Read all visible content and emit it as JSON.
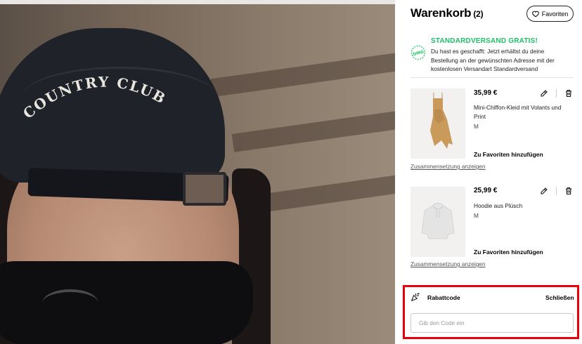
{
  "hero": {
    "cap_text": "COUNTRY CLUB"
  },
  "cart": {
    "title": "Warenkorb",
    "count": "(2)",
    "favorites_button": "Favoriten"
  },
  "shipping": {
    "title": "STANDARDVERSAND GRATIS!",
    "text": "Du hast es geschafft: Jetzt erhältst du deine Bestellung an der gewünschten Adresse mit der kostenlosen Versandart Standardversand",
    "icon": "omg-stamp-icon",
    "color": "#1fbf6a"
  },
  "items": [
    {
      "price": "35,99 €",
      "name": "Mini-Chiffon-Kleid mit Volants und Print",
      "size": "M",
      "favorite_link": "Zu Favoriten hinzufügen",
      "composition_link": "Zusammensetzung anzeigen"
    },
    {
      "price": "25,99 €",
      "name": "Hoodie aus Plüsch",
      "size": "M",
      "favorite_link": "Zu Favoriten hinzufügen",
      "composition_link": "Zusammensetzung anzeigen"
    }
  ],
  "promo": {
    "label": "Rabattcode",
    "close": "Schließen",
    "placeholder": "Gib den Code ein",
    "highlight_color": "#e8000b"
  }
}
